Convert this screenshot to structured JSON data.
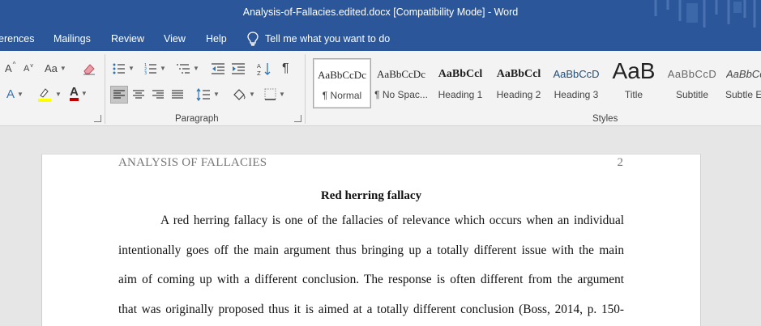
{
  "window": {
    "title": "Analysis-of-Fallacies.edited.docx [Compatibility Mode]  -  Word"
  },
  "tabs": [
    {
      "label": "erences"
    },
    {
      "label": "Mailings"
    },
    {
      "label": "Review"
    },
    {
      "label": "View"
    },
    {
      "label": "Help"
    }
  ],
  "tell_me": {
    "label": "Tell me what you want to do"
  },
  "ribbon": {
    "font_group": {
      "grow_font": "A",
      "shrink_font": "A",
      "change_case": "Aa",
      "text_effects": "A",
      "font_color": "A",
      "highlight_color": "#ffff00",
      "font_color_value": "#c00000"
    },
    "paragraph_group": {
      "label": "Paragraph"
    },
    "styles_group": {
      "label": "Styles",
      "styles": [
        {
          "sample": "AaBbCcDc",
          "name": "¶ Normal"
        },
        {
          "sample": "AaBbCcDc",
          "name": "¶ No Spac..."
        },
        {
          "sample": "AaBbCcl",
          "name": "Heading 1"
        },
        {
          "sample": "AaBbCcl",
          "name": "Heading 2"
        },
        {
          "sample": "AaBbCcD",
          "name": "Heading 3"
        },
        {
          "sample": "AaB",
          "name": "Title"
        },
        {
          "sample": "AaBbCcD",
          "name": "Subtitle"
        },
        {
          "sample": "AaBbCcl",
          "name": "Subtle Em"
        }
      ]
    }
  },
  "document": {
    "running_head": "ANALYSIS OF FALLACIES",
    "page_number": "2",
    "heading": "Red herring fallacy",
    "lines": [
      "A red herring fallacy is one of the fallacies of relevance which occurs when an individual",
      "intentionally goes off the main argument thus bringing up a totally different issue with the main",
      "aim of coming up with a different conclusion. The response is often different from the argument",
      "that was originally proposed thus it is aimed at a totally different conclusion (Boss, 2014, p. 150-"
    ]
  },
  "colors": {
    "titlebar": "#2b579a",
    "ribbon": "#f3f3f3",
    "workspace": "#e6e6e6"
  }
}
